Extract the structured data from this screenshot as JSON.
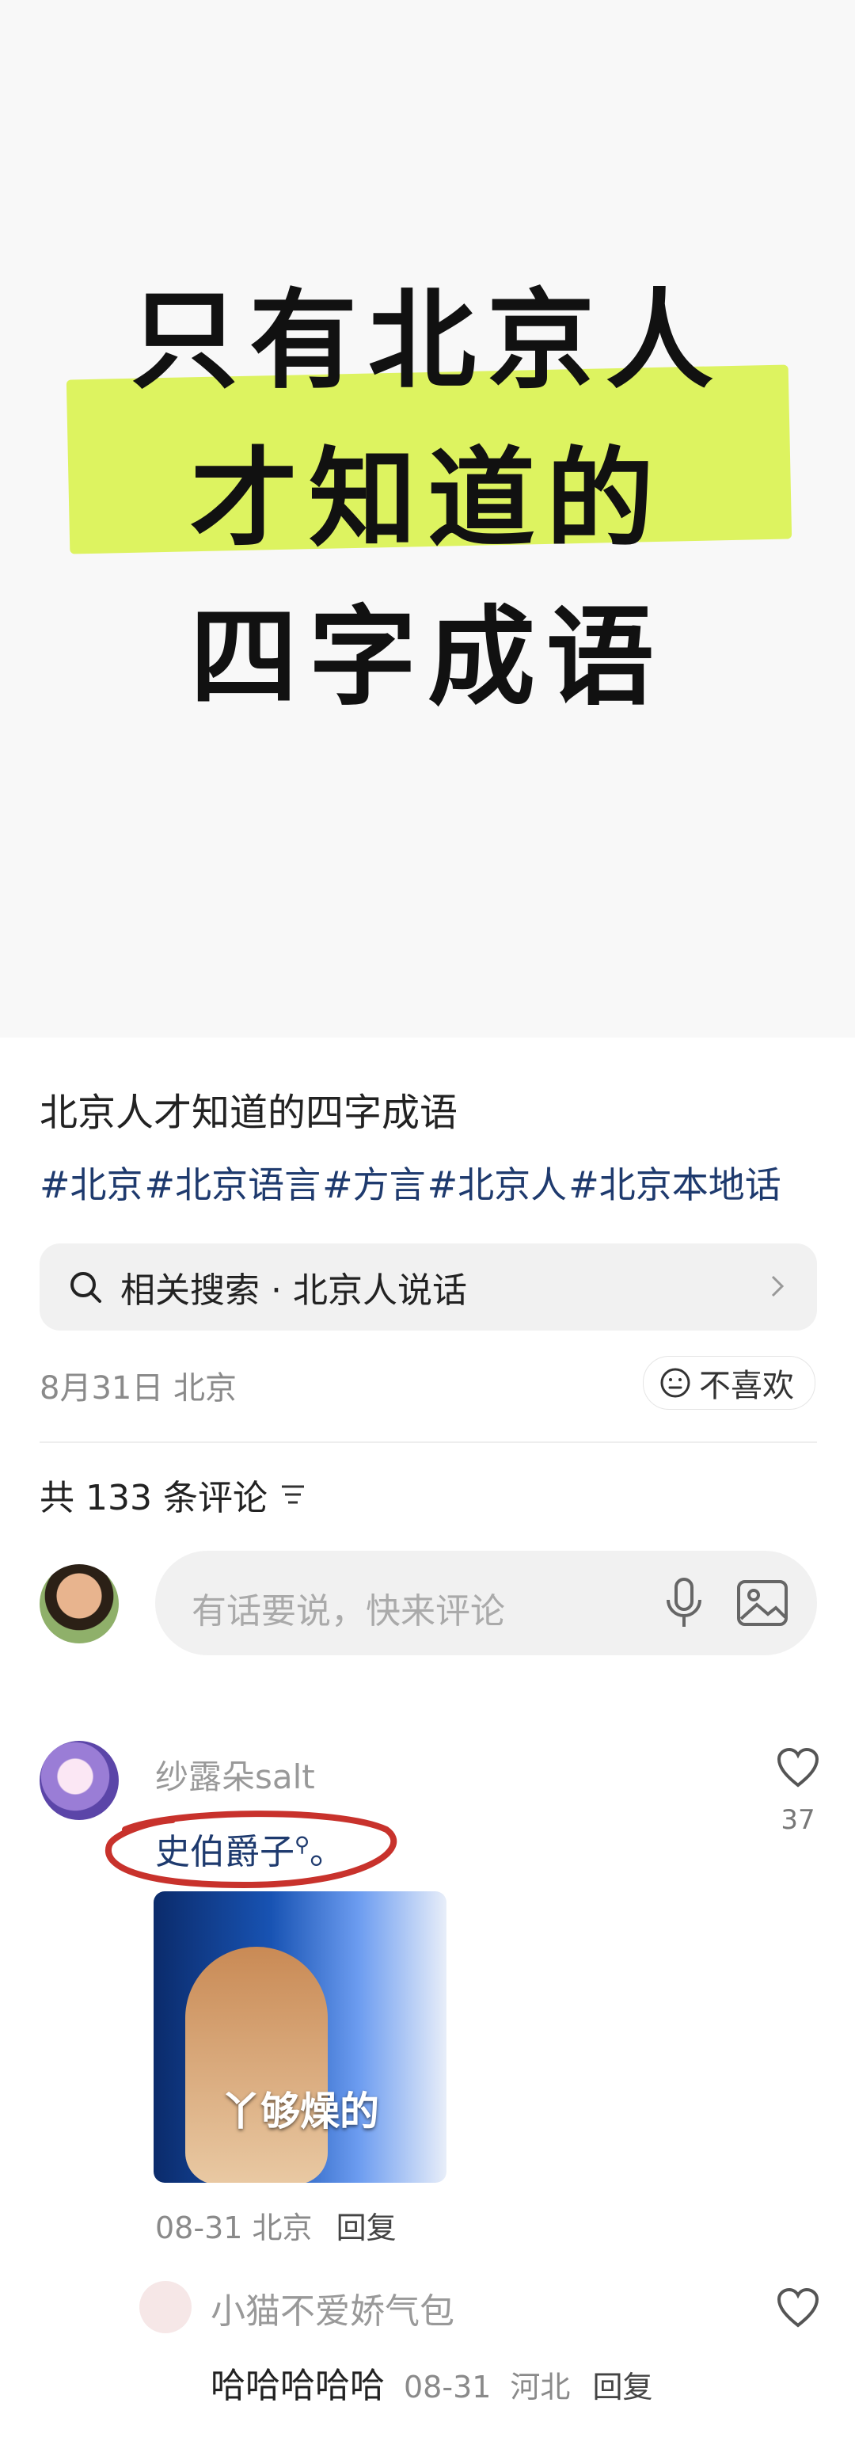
{
  "cover": {
    "line1": "只有北京人",
    "line2": "才知道的",
    "line3": "四字成语",
    "highlight_color": "#d9f24f"
  },
  "post": {
    "title": "北京人才知道的四字成语",
    "tags": [
      "#北京",
      "#北京语言",
      "#方言",
      "#北京人",
      "#北京本地话"
    ],
    "tag_color": "#1e3a6e",
    "related_search": "相关搜索 · 北京人说话",
    "date_location": "8月31日 北京",
    "dislike_label": "不喜欢"
  },
  "comments_header": {
    "count_label": "共 133 条评论"
  },
  "comment_input": {
    "placeholder": "有话要说，快来评论"
  },
  "comments": [
    {
      "user": "纱露朵salt",
      "text": "史伯爵子",
      "text_suffix": "。",
      "likes": "37",
      "meme_caption": "丫够燥的",
      "date": "08-31",
      "location": "北京",
      "reply_label": "回复",
      "annotation_color": "#c8322c"
    },
    {
      "user": "小猫不爱娇气包",
      "text": "哈哈哈哈哈",
      "date": "08-31",
      "location": "河北",
      "reply_label": "回复"
    }
  ]
}
